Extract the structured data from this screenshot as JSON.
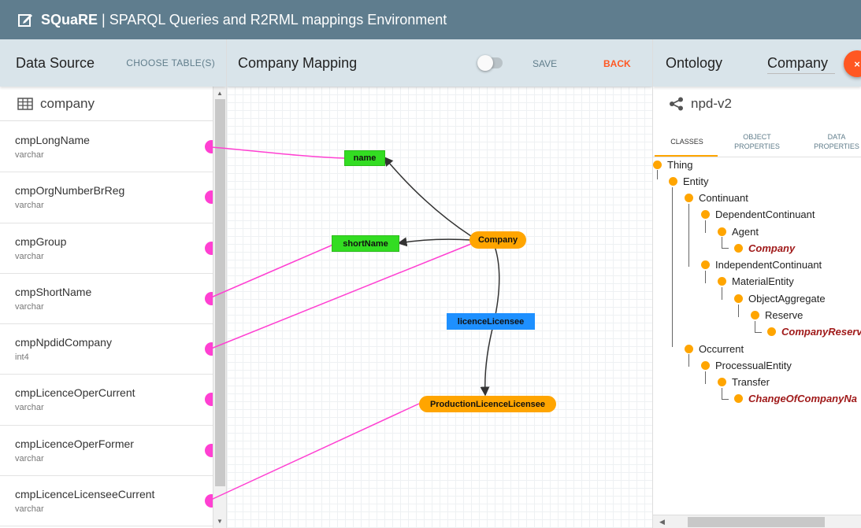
{
  "header": {
    "brand": "SQuaRE",
    "separator": "|",
    "title": "SPARQL Queries and R2RML mappings Environment"
  },
  "data_source": {
    "title": "Data Source",
    "choose_label": "CHOOSE TABLE(S)",
    "table_name": "company",
    "columns": [
      {
        "name": "cmpLongName",
        "type": "varchar"
      },
      {
        "name": "cmpOrgNumberBrReg",
        "type": "varchar"
      },
      {
        "name": "cmpGroup",
        "type": "varchar"
      },
      {
        "name": "cmpShortName",
        "type": "varchar"
      },
      {
        "name": "cmpNpdidCompany",
        "type": "int4"
      },
      {
        "name": "cmpLicenceOperCurrent",
        "type": "varchar"
      },
      {
        "name": "cmpLicenceOperFormer",
        "type": "varchar"
      },
      {
        "name": "cmpLicenceLicenseeCurrent",
        "type": "varchar"
      }
    ]
  },
  "mapping": {
    "title": "Company Mapping",
    "save_label": "SAVE",
    "back_label": "BACK",
    "toggle_on": false,
    "nodes": {
      "name": "name",
      "shortName": "shortName",
      "company": "Company",
      "licenceLicensee": "licenceLicensee",
      "productionLicence": "ProductionLicenceLicensee"
    },
    "colors": {
      "data_property": "#33dd22",
      "class": "#ffa500",
      "object_property": "#1e90ff",
      "link": "#ff40d2"
    }
  },
  "ontology": {
    "title": "Ontology",
    "search_value": "Company",
    "close_label": "×",
    "name": "npd-v2",
    "tabs": {
      "classes": "CLASSES",
      "object_l1": "OBJECT",
      "object_l2": "PROPERTIES",
      "data_l1": "DATA",
      "data_l2": "PROPERTIES"
    },
    "tree": {
      "thing": "Thing",
      "entity": "Entity",
      "continuant": "Continuant",
      "dependent": "DependentContinuant",
      "agent": "Agent",
      "company": "Company",
      "independent": "IndependentContinuant",
      "material": "MaterialEntity",
      "aggregate": "ObjectAggregate",
      "reserve": "Reserve",
      "company_reserve": "CompanyReserv",
      "occurrent": "Occurrent",
      "processual": "ProcessualEntity",
      "transfer": "Transfer",
      "change": "ChangeOfCompanyNa"
    },
    "accent": "#ffa500"
  }
}
